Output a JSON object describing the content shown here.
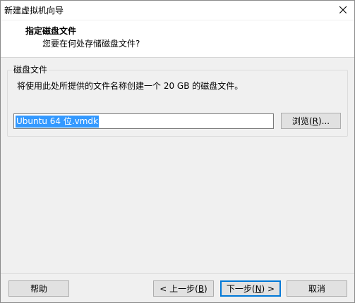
{
  "window": {
    "title": "新建虚拟机向导"
  },
  "header": {
    "title": "指定磁盘文件",
    "subtitle": "您要在何处存储磁盘文件?"
  },
  "disk_group": {
    "legend": "磁盘文件",
    "description": "将使用此处所提供的文件名称创建一个 20 GB 的磁盘文件。",
    "file_value": "Ubuntu 64 位.vmdk",
    "browse_label_pre": "浏览(",
    "browse_accel": "R",
    "browse_label_post": ")..."
  },
  "footer": {
    "help_label": "帮助",
    "back_pre": "< 上一步(",
    "back_accel": "B",
    "back_post": ")",
    "next_pre": "下一步(",
    "next_accel": "N",
    "next_post": ") >",
    "cancel_label": "取消"
  }
}
